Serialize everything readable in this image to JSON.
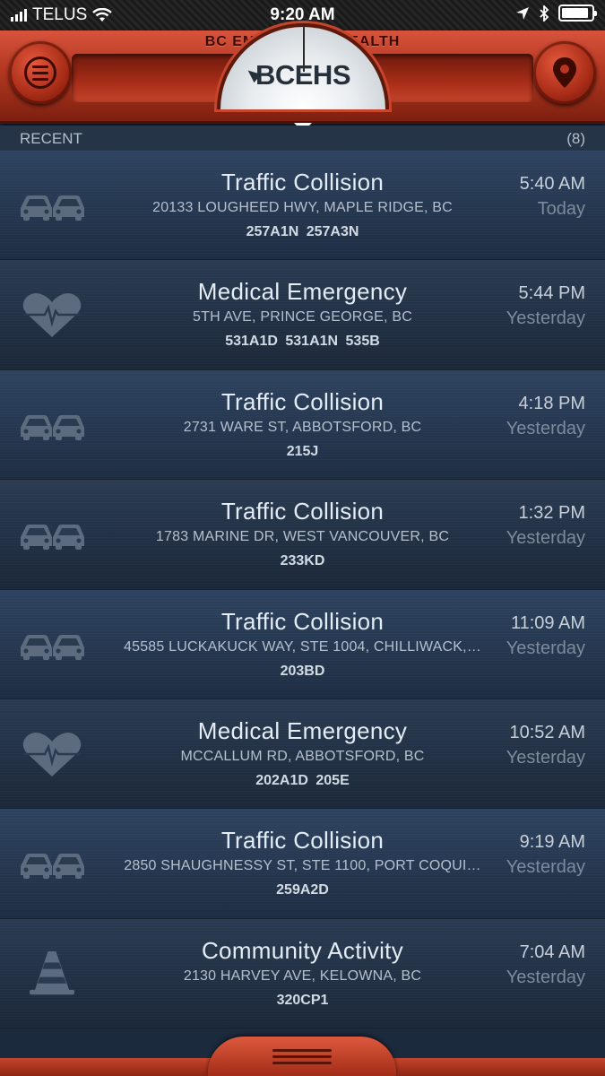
{
  "status_bar": {
    "carrier": "TELUS",
    "time": "9:20 AM"
  },
  "header": {
    "title": "BC EMERGENCY HEALTH",
    "logo": "BCEHS",
    "menu_icon": "menu-icon",
    "location_icon": "location-pin-icon"
  },
  "recent": {
    "label": "RECENT",
    "count": "(8)"
  },
  "incidents": [
    {
      "icon": "cars-icon",
      "title": "Traffic Collision",
      "address": "20133 LOUGHEED HWY, MAPLE RIDGE, BC",
      "units": "257A1N  257A3N",
      "time": "5:40 AM",
      "day": "Today"
    },
    {
      "icon": "heart-icon",
      "title": "Medical Emergency",
      "address": "5TH AVE, PRINCE GEORGE, BC",
      "units": "531A1D  531A1N  535B",
      "time": "5:44 PM",
      "day": "Yesterday"
    },
    {
      "icon": "cars-icon",
      "title": "Traffic Collision",
      "address": "2731 WARE ST, ABBOTSFORD, BC",
      "units": "215J",
      "time": "4:18 PM",
      "day": "Yesterday"
    },
    {
      "icon": "cars-icon",
      "title": "Traffic Collision",
      "address": "1783 MARINE DR, WEST VANCOUVER, BC",
      "units": "233KD",
      "time": "1:32 PM",
      "day": "Yesterday"
    },
    {
      "icon": "cars-icon",
      "title": "Traffic Collision",
      "address": "45585 LUCKAKUCK WAY, STE 1004, CHILLIWACK,…",
      "units": "203BD",
      "time": "11:09 AM",
      "day": "Yesterday"
    },
    {
      "icon": "heart-icon",
      "title": "Medical Emergency",
      "address": "MCCALLUM RD, ABBOTSFORD, BC",
      "units": "202A1D  205E",
      "time": "10:52 AM",
      "day": "Yesterday"
    },
    {
      "icon": "cars-icon",
      "title": "Traffic Collision",
      "address": "2850 SHAUGHNESSY ST, STE 1100, PORT COQUI…",
      "units": "259A2D",
      "time": "9:19 AM",
      "day": "Yesterday"
    },
    {
      "icon": "cone-icon",
      "title": "Community Activity",
      "address": "2130 HARVEY AVE, KELOWNA, BC",
      "units": "320CP1",
      "time": "7:04 AM",
      "day": "Yesterday"
    }
  ]
}
